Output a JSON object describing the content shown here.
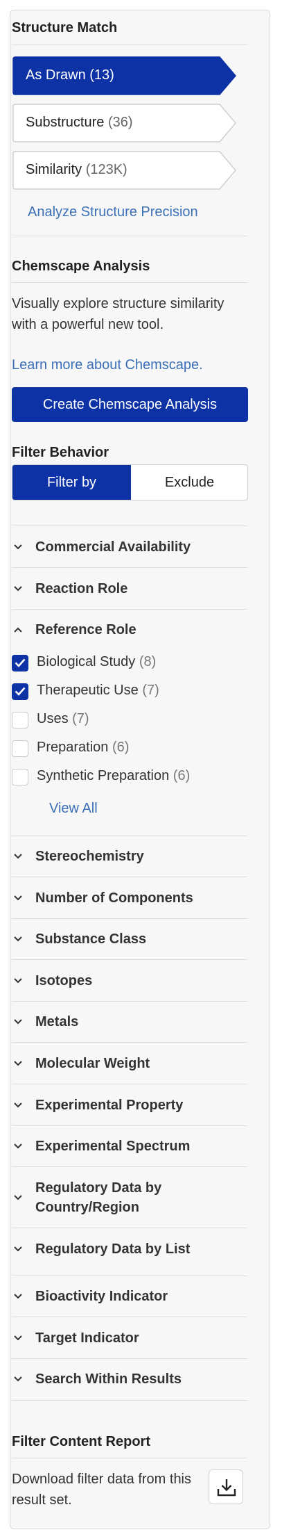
{
  "structure_match": {
    "title": "Structure Match",
    "options": [
      {
        "label": "As Drawn",
        "count": "(13)",
        "active": true
      },
      {
        "label": "Substructure",
        "count": "(36)",
        "active": false
      },
      {
        "label": "Similarity",
        "count": "(123K)",
        "active": false
      }
    ],
    "precision_link": "Analyze Structure Precision"
  },
  "chemscape": {
    "title": "Chemscape Analysis",
    "description": "Visually explore structure similarity with a powerful new tool.",
    "learn_more": "Learn more about Chemscape.",
    "cta": "Create Chemscape Analysis"
  },
  "filter_behavior": {
    "title": "Filter Behavior",
    "filter_by": "Filter by",
    "exclude": "Exclude",
    "selected": "Filter by"
  },
  "accordions_top": [
    "Commercial Availability",
    "Reaction Role"
  ],
  "reference_role": {
    "title": "Reference Role",
    "expanded": true,
    "items": [
      {
        "label": "Biological Study",
        "count": "(8)",
        "checked": true
      },
      {
        "label": "Therapeutic Use",
        "count": "(7)",
        "checked": true
      },
      {
        "label": "Uses",
        "count": "(7)",
        "checked": false
      },
      {
        "label": "Preparation",
        "count": "(6)",
        "checked": false
      },
      {
        "label": "Synthetic Preparation",
        "count": "(6)",
        "checked": false
      }
    ],
    "view_all": "View All"
  },
  "accordions_bottom": [
    "Stereochemistry",
    "Number of Components",
    "Substance Class",
    "Isotopes",
    "Metals",
    "Molecular Weight",
    "Experimental Property",
    "Experimental Spectrum",
    "Regulatory Data by Country/Region",
    "Regulatory Data by List",
    "Bioactivity Indicator",
    "Target Indicator",
    "Search Within Results"
  ],
  "report": {
    "title": "Filter Content Report",
    "description": "Download filter data from this result set."
  },
  "colors": {
    "accent": "#0d32a6",
    "link": "#3b6fb6",
    "panel_bg": "#f7f7f7",
    "border": "#d9d9d9"
  }
}
